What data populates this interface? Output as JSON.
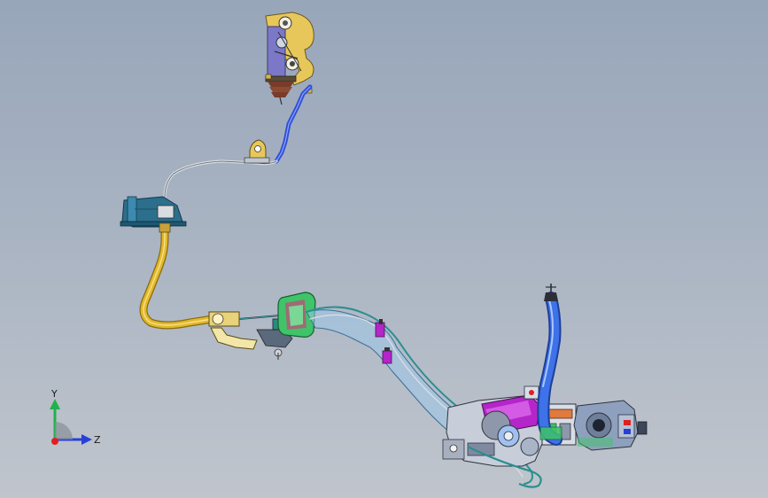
{
  "triad": {
    "y_label": "Y",
    "z_label": "Z"
  },
  "colors": {
    "background_top": "#98a6ba",
    "background_bottom": "#c0c5cc",
    "cable_sheath": "#d9dde2",
    "yellow_hose": "#e2b92a",
    "blue_conduit": "#2f4fd6",
    "teal_bracket": "#2b6f8c",
    "green_reservoir": "#3fc46a",
    "purple_housing": "#b426c9",
    "gearbox_gray": "#8ea0bd",
    "y_axis": "#22b14c",
    "z_axis": "#2740d6",
    "x_axis_origin": "#e02020"
  }
}
